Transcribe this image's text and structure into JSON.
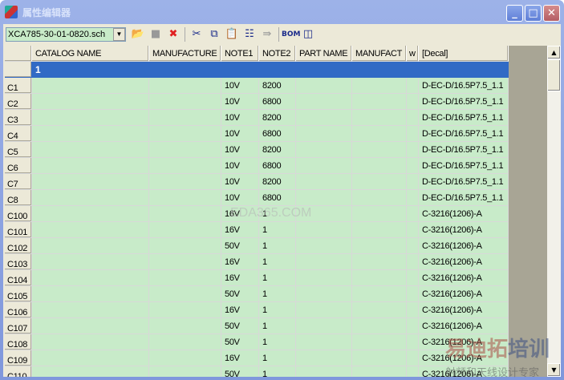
{
  "window": {
    "title": "属性编辑器",
    "minimize": "_",
    "maximize": "□",
    "close": "✕"
  },
  "toolbar": {
    "file_select": "XCA785-30-01-0820.sch",
    "icons": [
      "open-folder-icon",
      "save-icon",
      "delete-icon",
      "cut-icon",
      "copy-icon",
      "paste-icon",
      "grid-icon",
      "arrow-right-icon",
      "bom-icon",
      "columns-icon"
    ]
  },
  "grid": {
    "columns": [
      "CATALOG NAME",
      "MANUFACTURE",
      "NOTE1",
      "NOTE2",
      "PART NAME",
      "MANUFACT",
      "w",
      "[Decal]"
    ],
    "selected_row": "1",
    "rows": [
      {
        "ref": "C1",
        "note1": "10V",
        "note2": "8200",
        "decal": "D-EC-D/16.5P7.5_1.1"
      },
      {
        "ref": "C2",
        "note1": "10V",
        "note2": "6800",
        "decal": "D-EC-D/16.5P7.5_1.1"
      },
      {
        "ref": "C3",
        "note1": "10V",
        "note2": "8200",
        "decal": "D-EC-D/16.5P7.5_1.1"
      },
      {
        "ref": "C4",
        "note1": "10V",
        "note2": "6800",
        "decal": "D-EC-D/16.5P7.5_1.1"
      },
      {
        "ref": "C5",
        "note1": "10V",
        "note2": "8200",
        "decal": "D-EC-D/16.5P7.5_1.1"
      },
      {
        "ref": "C6",
        "note1": "10V",
        "note2": "6800",
        "decal": "D-EC-D/16.5P7.5_1.1"
      },
      {
        "ref": "C7",
        "note1": "10V",
        "note2": "8200",
        "decal": "D-EC-D/16.5P7.5_1.1"
      },
      {
        "ref": "C8",
        "note1": "10V",
        "note2": "6800",
        "decal": "D-EC-D/16.5P7.5_1.1"
      },
      {
        "ref": "C100",
        "note1": "16V",
        "note2": "1",
        "decal": "C-3216(1206)-A"
      },
      {
        "ref": "C101",
        "note1": "16V",
        "note2": "1",
        "decal": "C-3216(1206)-A"
      },
      {
        "ref": "C102",
        "note1": "50V",
        "note2": "1",
        "decal": "C-3216(1206)-A"
      },
      {
        "ref": "C103",
        "note1": "16V",
        "note2": "1",
        "decal": "C-3216(1206)-A"
      },
      {
        "ref": "C104",
        "note1": "16V",
        "note2": "1",
        "decal": "C-3216(1206)-A"
      },
      {
        "ref": "C105",
        "note1": "50V",
        "note2": "1",
        "decal": "C-3216(1206)-A"
      },
      {
        "ref": "C106",
        "note1": "16V",
        "note2": "1",
        "decal": "C-3216(1206)-A"
      },
      {
        "ref": "C107",
        "note1": "50V",
        "note2": "1",
        "decal": "C-3216(1206)-A"
      },
      {
        "ref": "C108",
        "note1": "50V",
        "note2": "1",
        "decal": "C-3216(1206)-A"
      },
      {
        "ref": "C109",
        "note1": "16V",
        "note2": "1",
        "decal": "C-3216(1206)-A"
      },
      {
        "ref": "C110",
        "note1": "50V",
        "note2": "1",
        "decal": "C-3216(1206)-A"
      }
    ]
  },
  "watermark": "EDA365.COM",
  "logo": {
    "line1": "易迪拓",
    "line1b": "培训",
    "line2": "射频和天线设计专家"
  }
}
